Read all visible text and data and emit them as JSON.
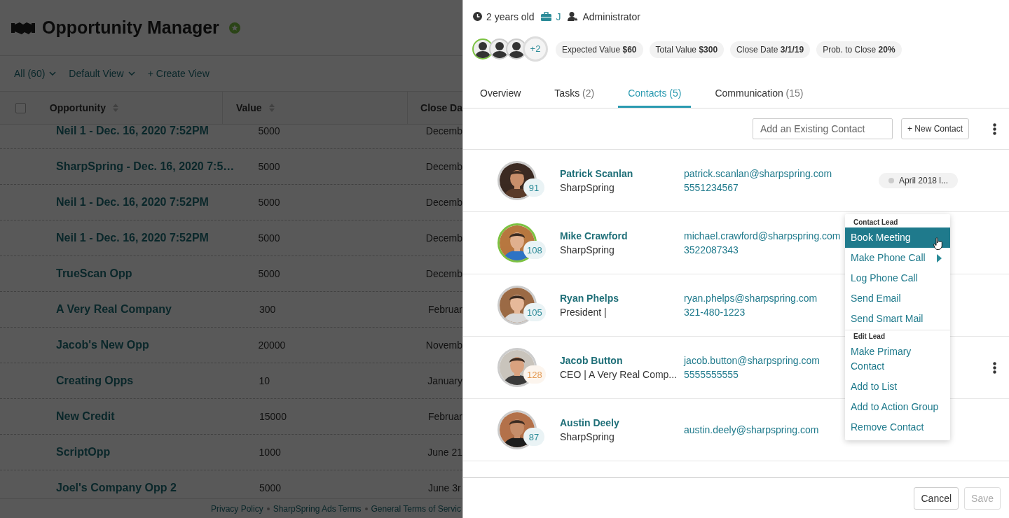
{
  "page": {
    "title": "Opportunity Manager",
    "filters": [
      {
        "label": "All (60)",
        "kind": "dropdown"
      },
      {
        "label": "Default View",
        "kind": "dropdown"
      },
      {
        "label": "+ Create View",
        "kind": "link"
      }
    ],
    "table": {
      "select_all": {
        "checked": false
      },
      "columns": [
        "Opportunity",
        "Value",
        "Close Da"
      ],
      "rows": [
        {
          "opportunity": "Neil 1 - Dec. 16, 2020 7:52PM",
          "value": "5000",
          "close_date": "Decemb"
        },
        {
          "opportunity": "SharpSpring - Dec. 16, 2020 7:5…",
          "value": "5000",
          "close_date": "Decemb"
        },
        {
          "opportunity": "Neil 1 - Dec. 16, 2020 7:52PM",
          "value": "5000",
          "close_date": "Decemb"
        },
        {
          "opportunity": "Neil 1 - Dec. 16, 2020 7:52PM",
          "value": "5000",
          "close_date": "Decemb"
        },
        {
          "opportunity": "TrueScan Opp",
          "value": "5000",
          "close_date": "Decemb"
        },
        {
          "opportunity": "A Very Real Company",
          "value": "300",
          "close_date": "Februar"
        },
        {
          "opportunity": "Jacob's New Opp",
          "value": "20000",
          "close_date": "Novemb"
        },
        {
          "opportunity": "Creating Opps",
          "value": "10",
          "close_date": "January"
        },
        {
          "opportunity": "New Credit",
          "value": "15000",
          "close_date": "Februar"
        },
        {
          "opportunity": "ScriptOpp",
          "value": "1000",
          "close_date": "June 21"
        },
        {
          "opportunity": "Joel's Company Opp 2",
          "value": "5000",
          "close_date": "June 3r"
        }
      ]
    },
    "footer_links": [
      "Privacy Policy",
      "SharpSpring Ads Terms",
      "General Terms of Servic"
    ]
  },
  "panel": {
    "meta": [
      {
        "kind": "age",
        "text": "2 years old"
      },
      {
        "kind": "owner",
        "text": "J"
      },
      {
        "kind": "role",
        "text": "Administrator"
      }
    ],
    "team": {
      "avatars": [
        {
          "primary": true
        },
        {
          "primary": false
        },
        {
          "primary": false
        }
      ],
      "more": "+2"
    },
    "stats": [
      "Expected Value **$60**",
      "Total Value **$300**",
      "Close Date **3/1/19**",
      "Prob. to Close **20%**"
    ],
    "tabs": [
      {
        "label": "Overview",
        "selected": false
      },
      {
        "label": "Tasks",
        "count": "(2)",
        "selected": false
      },
      {
        "label": "Contacts",
        "count": "(5)",
        "selected": true
      },
      {
        "label": "Communication",
        "count": "(15)",
        "selected": false
      }
    ],
    "search": {
      "placeholder": "Add an Existing Contact"
    },
    "new_contact": "+ New Contact",
    "contacts": [
      {
        "name": "Patrick Scanlan",
        "subtitle": "SharpSpring",
        "email": "patrick.scanlan@sharpspring.com",
        "phone": "5551234567",
        "score": "91",
        "color": "#2a8a97",
        "primary": false,
        "tag": "April 2018 l...",
        "row_menu": false
      },
      {
        "name": "Mike Crawford",
        "subtitle": "SharpSpring",
        "email": "michael.crawford@sharpspring.com",
        "phone": "3522087343",
        "score": "108",
        "color": "#2a8a97",
        "primary": true,
        "row_menu": false
      },
      {
        "name": "Ryan Phelps",
        "subtitle": "President |",
        "email": "ryan.phelps@sharpspring.com",
        "phone": "321-480-1223",
        "score": "105",
        "color": "#2a8a97",
        "primary": false,
        "row_menu": false
      },
      {
        "name": "Jacob Button",
        "subtitle": "CEO | A Very Real Comp...",
        "email": "jacob.button@sharpspring.com",
        "phone": "5555555555",
        "score": "128",
        "color": "#e39b55",
        "primary": false,
        "row_menu": true
      },
      {
        "name": "Austin Deely",
        "subtitle": "SharpSpring",
        "email": "austin.deely@sharpspring.com",
        "score": "87",
        "color": "#2a8a97",
        "primary": false,
        "row_menu": false
      }
    ],
    "menu": {
      "sections": [
        {
          "title": "Contact Lead",
          "items": [
            {
              "label": "Book Meeting",
              "selected": true,
              "submenu": false
            },
            {
              "label": "Make Phone Call",
              "selected": false,
              "submenu": true
            },
            {
              "label": "Log Phone Call",
              "selected": false,
              "submenu": false
            },
            {
              "label": "Send Email",
              "selected": false,
              "submenu": false
            },
            {
              "label": "Send Smart Mail",
              "selected": false,
              "submenu": false
            }
          ]
        },
        {
          "title": "Edit Lead",
          "items": [
            {
              "label": "Make Primary Contact",
              "selected": false,
              "submenu": false
            },
            {
              "label": "Add to List",
              "selected": false,
              "submenu": false
            },
            {
              "label": "Add to Action Group",
              "selected": false,
              "submenu": false
            },
            {
              "label": "Remove Contact",
              "selected": false,
              "submenu": false
            }
          ]
        }
      ]
    },
    "buttons": [
      {
        "label": "Cancel",
        "disabled": false
      },
      {
        "label": "Save",
        "disabled": true
      }
    ]
  }
}
